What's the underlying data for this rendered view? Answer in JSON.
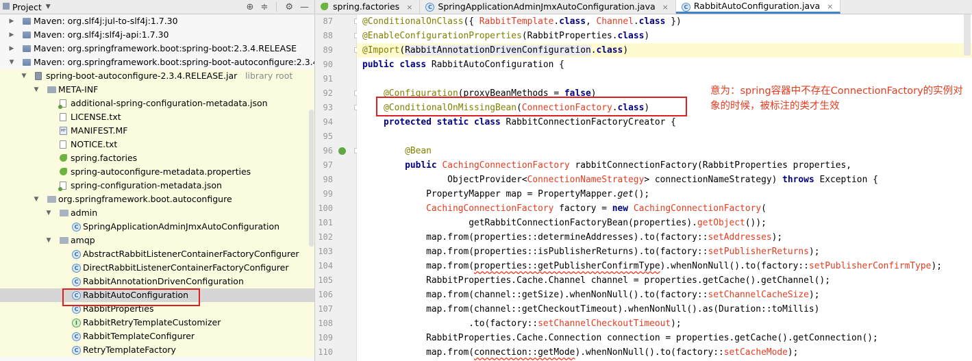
{
  "project_panel": {
    "title": "Project",
    "tree": [
      {
        "label": "Maven: org.slf4j:jul-to-slf4j:1.7.30",
        "indent": 0,
        "icon": "library-icon",
        "arrow": "right",
        "hl": false
      },
      {
        "label": "Maven: org.slf4j:slf4j-api:1.7.30",
        "indent": 0,
        "icon": "library-icon",
        "arrow": "right",
        "hl": false
      },
      {
        "label": "Maven: org.springframework.boot:spring-boot:2.3.4.RELEASE",
        "indent": 0,
        "icon": "library-icon",
        "arrow": "right",
        "hl": false
      },
      {
        "label": "Maven: org.springframework.boot:spring-boot-autoconfigure:2.3.4.RELEASE",
        "indent": 0,
        "icon": "library-icon",
        "arrow": "down",
        "hl": false
      },
      {
        "label": "spring-boot-autoconfigure-2.3.4.RELEASE.jar",
        "suffix": "library root",
        "indent": 1,
        "icon": "jar-icon",
        "arrow": "down",
        "hl": true
      },
      {
        "label": "META-INF",
        "indent": 2,
        "icon": "folder-icon",
        "arrow": "down",
        "hl": true
      },
      {
        "label": "additional-spring-configuration-metadata.json",
        "indent": 3,
        "icon": "json-file-icon",
        "arrow": "",
        "hl": true
      },
      {
        "label": "LICENSE.txt",
        "indent": 3,
        "icon": "text-file-icon",
        "arrow": "",
        "hl": true
      },
      {
        "label": "MANIFEST.MF",
        "indent": 3,
        "icon": "manifest-file-icon",
        "arrow": "",
        "hl": true
      },
      {
        "label": "NOTICE.txt",
        "indent": 3,
        "icon": "text-file-icon",
        "arrow": "",
        "hl": true
      },
      {
        "label": "spring.factories",
        "indent": 3,
        "icon": "spring-leaf-icon",
        "arrow": "",
        "hl": true
      },
      {
        "label": "spring-autoconfigure-metadata.properties",
        "indent": 3,
        "icon": "properties-file-icon",
        "arrow": "",
        "hl": true
      },
      {
        "label": "spring-configuration-metadata.json",
        "indent": 3,
        "icon": "json-file-icon",
        "arrow": "",
        "hl": true
      },
      {
        "label": "org.springframework.boot.autoconfigure",
        "indent": 2,
        "icon": "package-icon",
        "arrow": "down",
        "hl": true
      },
      {
        "label": "admin",
        "indent": 3,
        "icon": "package-icon",
        "arrow": "down",
        "hl": true
      },
      {
        "label": "SpringApplicationAdminJmxAutoConfiguration",
        "indent": 4,
        "icon": "class-icon",
        "arrow": "",
        "hl": true
      },
      {
        "label": "amqp",
        "indent": 3,
        "icon": "package-icon",
        "arrow": "down",
        "hl": true
      },
      {
        "label": "AbstractRabbitListenerContainerFactoryConfigurer",
        "indent": 4,
        "icon": "class-icon",
        "arrow": "",
        "hl": true
      },
      {
        "label": "DirectRabbitListenerContainerFactoryConfigurer",
        "indent": 4,
        "icon": "class-icon",
        "arrow": "",
        "hl": true
      },
      {
        "label": "RabbitAnnotationDrivenConfiguration",
        "indent": 4,
        "icon": "class-icon",
        "arrow": "",
        "hl": true
      },
      {
        "label": "RabbitAutoConfiguration",
        "indent": 4,
        "icon": "class-icon",
        "arrow": "",
        "hl": false,
        "selected": true
      },
      {
        "label": "RabbitProperties",
        "indent": 4,
        "icon": "class-icon",
        "arrow": "",
        "hl": true
      },
      {
        "label": "RabbitRetryTemplateCustomizer",
        "indent": 4,
        "icon": "interface-icon",
        "arrow": "",
        "hl": true
      },
      {
        "label": "RabbitTemplateConfigurer",
        "indent": 4,
        "icon": "class-icon",
        "arrow": "",
        "hl": true
      },
      {
        "label": "RetryTemplateFactory",
        "indent": 4,
        "icon": "class-icon",
        "arrow": "",
        "hl": true
      }
    ]
  },
  "tabs": [
    {
      "label": "spring.factories",
      "icon": "spring-leaf-icon",
      "active": false
    },
    {
      "label": "SpringApplicationAdminJmxAutoConfiguration.java",
      "icon": "class-icon",
      "active": false
    },
    {
      "label": "RabbitAutoConfiguration.java",
      "icon": "class-icon",
      "active": true
    }
  ],
  "editor": {
    "line_numbers": [
      "87",
      "88",
      "89",
      "90",
      "91",
      "92",
      "93",
      "94",
      "95",
      "96",
      "97",
      "98",
      "99",
      "100",
      "101",
      "102",
      "103",
      "104",
      "105",
      "106",
      "107",
      "108",
      "109",
      "110"
    ],
    "annotation_note": "意为：spring容器中不存在ConnectionFactory的实例对象的时候，被标注的类才生效"
  },
  "colors": {
    "accent": "#4083c9",
    "annotation": "#808000",
    "keyword": "#000080",
    "reference": "#e53c1f",
    "highlight_box": "#e02020"
  }
}
